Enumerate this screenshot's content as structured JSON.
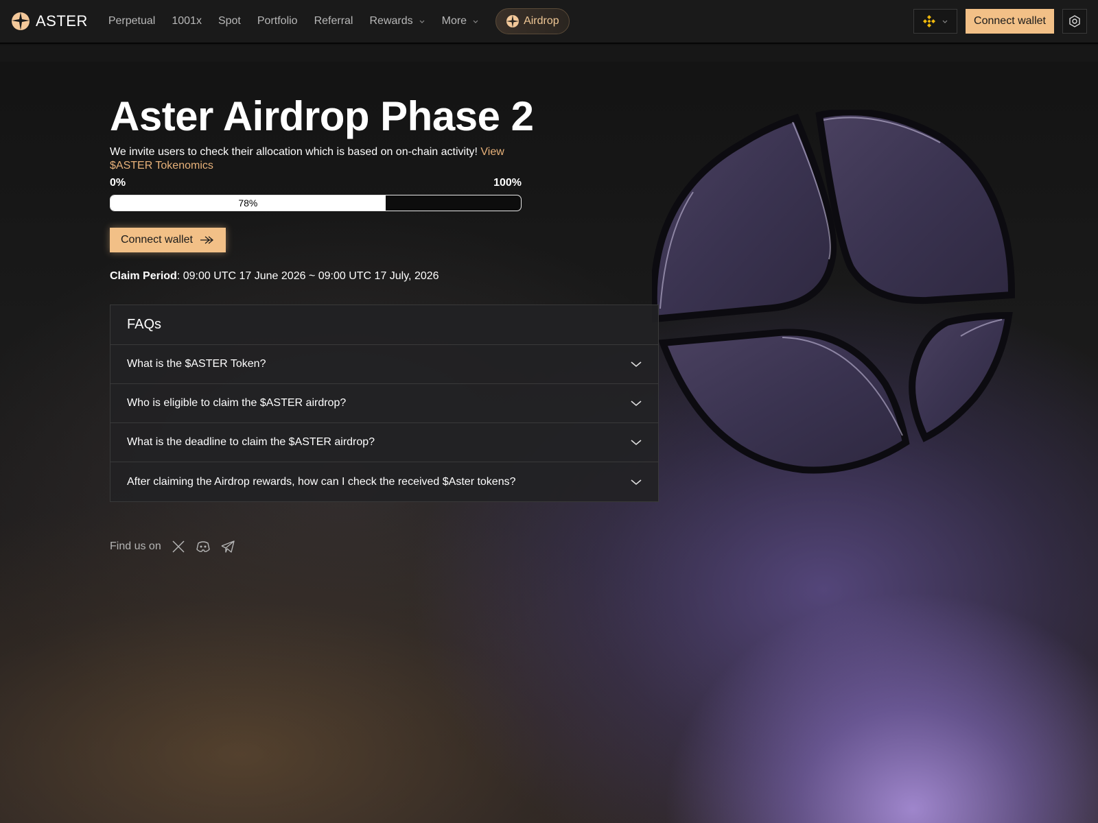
{
  "header": {
    "brand": "ASTER",
    "nav": [
      {
        "label": "Perpetual"
      },
      {
        "label": "1001x"
      },
      {
        "label": "Spot"
      },
      {
        "label": "Portfolio"
      },
      {
        "label": "Referral"
      },
      {
        "label": "Rewards",
        "dropdown": true
      },
      {
        "label": "More",
        "dropdown": true
      }
    ],
    "airdrop_label": "Airdrop",
    "chain_icon": "bnb-chain-icon",
    "connect_label": "Connect wallet",
    "settings_icon": "settings-icon"
  },
  "main": {
    "title": "Aster Airdrop Phase 2",
    "intro_text": "We invite users to check their allocation which is based on on-chain activity!",
    "intro_link": "View $ASTER Tokenomics",
    "progress": {
      "min_label": "0%",
      "max_label": "100%",
      "value_label": "78%",
      "value": 0.67
    },
    "connect_label": "Connect wallet",
    "claim_label": "Claim Period",
    "claim_value": ": 09:00 UTC 17 June 2026 ~ 09:00 UTC 17 July, 2026",
    "faq": {
      "title": "FAQs",
      "items": [
        "What is the $ASTER Token?",
        "Who is eligible to claim the $ASTER airdrop?",
        "What is the deadline to claim the $ASTER airdrop?",
        "After claiming the Airdrop rewards, how can I check the received $Aster tokens?"
      ]
    },
    "find_us": "Find us on",
    "socials": [
      "x-icon",
      "discord-icon",
      "telegram-icon"
    ]
  },
  "colors": {
    "accent": "#f2c087",
    "link": "#e8b27a",
    "emblem": "#3a3248"
  }
}
